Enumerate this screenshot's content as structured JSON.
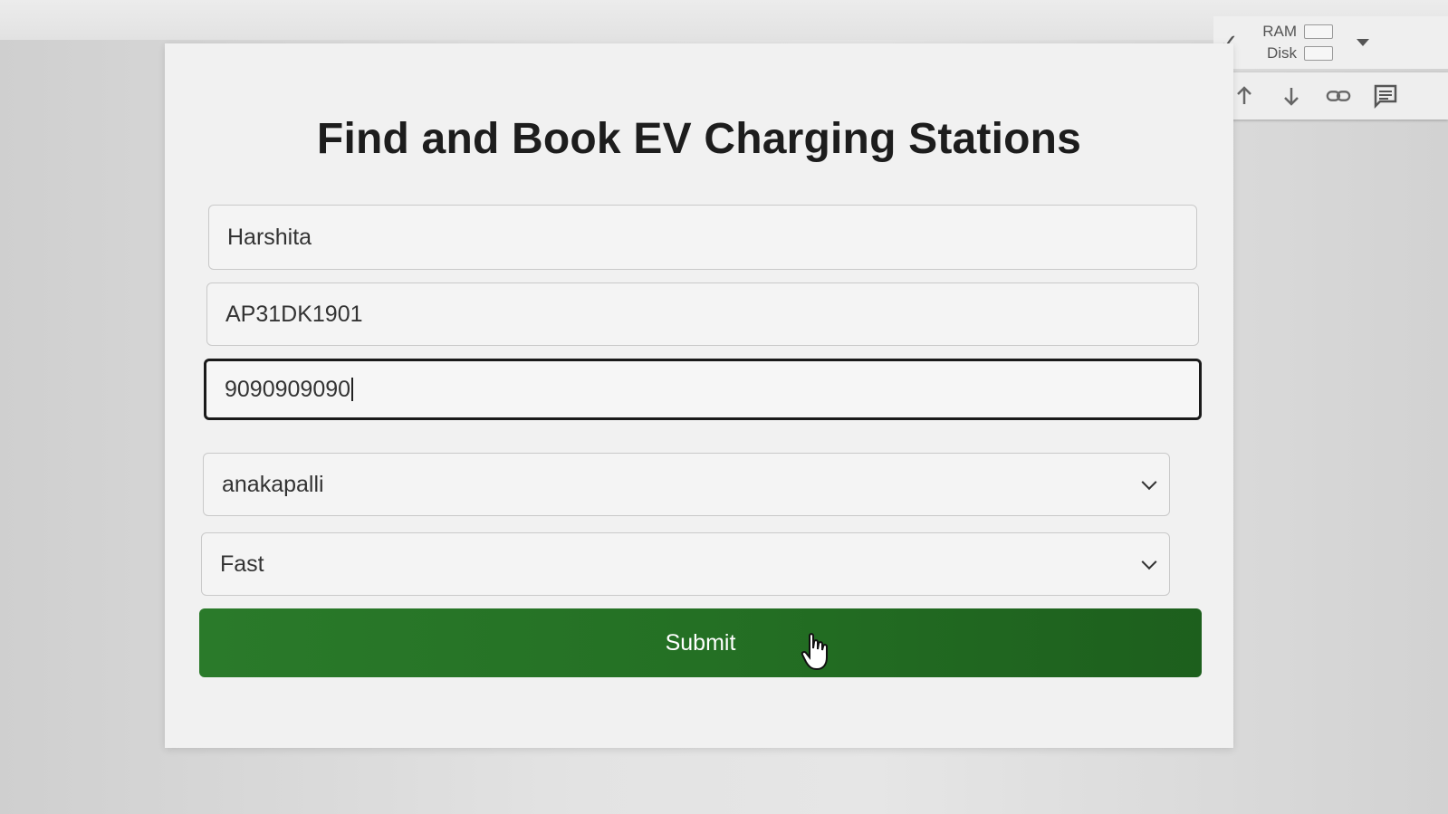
{
  "status_bar": {
    "ram_label": "RAM",
    "disk_label": "Disk",
    "icons": [
      "check-icon",
      "dropdown-icon"
    ]
  },
  "cell_toolbar": {
    "icons": [
      "arrow-up-icon",
      "arrow-down-icon",
      "link-icon",
      "comment-icon"
    ]
  },
  "form": {
    "title": "Find and Book EV Charging Stations",
    "name_value": "Harshita",
    "vehicle_value": "AP31DK1901",
    "phone_value": "9090909090",
    "location_selected": "anakapalli",
    "charger_type_selected": "Fast",
    "submit_label": "Submit",
    "colors": {
      "submit_green": "#247024",
      "focus_border": "#1a1a1a"
    }
  }
}
